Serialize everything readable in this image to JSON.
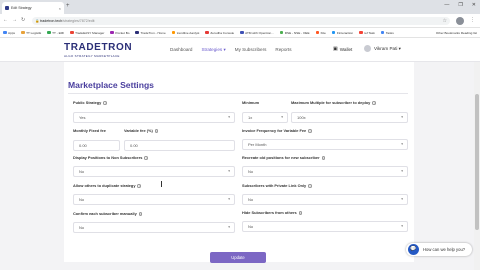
{
  "browser": {
    "tab_title": "Edit Strategy",
    "tab_close": "×",
    "new_tab": "+",
    "window_controls": [
      "—",
      "❐",
      "✕"
    ],
    "url_host": "tradetron.tech",
    "url_path": "/strategies/7872/edit",
    "bookmarks": [
      "Apps",
      "TT Logistik",
      "TT - EMI",
      "TradeEASY Manager",
      "Pocket Bo",
      "TradeTron - Home",
      "trendline Aanlyst",
      "Zerodha Console",
      "ATM with Opention...",
      "RSE - NSE - OEE",
      "Kite",
      "Finteraction",
      "ref Task",
      "Tasks",
      "Other Bookmarks",
      "Reading list"
    ],
    "bookmark_colors": [
      "#4285f4",
      "#e8a23a",
      "#34a853",
      "#ea4335",
      "#9c27b0",
      "#2b2f77",
      "#ff9800",
      "#e53935",
      "#3f51b5",
      "#4caf50",
      "#ff5722",
      "#2196f3",
      "#f44336",
      "#4285f4"
    ]
  },
  "app": {
    "logo_title": "TRADETRON",
    "logo_subtitle": "ALGO STRATEGY MARKETPLACE",
    "nav": [
      {
        "label": "Dashboard",
        "active": false
      },
      {
        "label": "Strategies ▾",
        "active": true
      },
      {
        "label": "My Subscribers",
        "active": false
      },
      {
        "label": "Reports",
        "active": false
      }
    ],
    "wallet_label": "Wallet",
    "user_name": "Vikram Pati ▾",
    "accent": "#6a5acd",
    "brand": "#2b2f77"
  },
  "form": {
    "title": "Marketplace Settings",
    "public_strategy": {
      "label": "Public Strategy",
      "value": "Yes"
    },
    "monthly_fixed_fee": {
      "label": "Monthly Fixed fee",
      "value": "0.00"
    },
    "variable_fee": {
      "label": "Variable fee (%)",
      "value": "0.00"
    },
    "display_positions": {
      "label": "Display Positions to Non Subscribers",
      "value": "No"
    },
    "allow_duplicate": {
      "label": "Allow others to duplicate strategy",
      "value": "No"
    },
    "confirm_manual": {
      "label": "Confirm each subscriber manually",
      "value": "No"
    },
    "minimum": {
      "label": "Minimum",
      "value": "1x"
    },
    "max_multiple": {
      "label": "Maximum Multiple for subscriber to deploy",
      "value": "100x"
    },
    "invoice_frequency": {
      "label": "Invoice Frequency for Variable Fee",
      "value": "Per Month"
    },
    "recreate_positions": {
      "label": "Recreate old positions for new subscriber",
      "value": "No"
    },
    "private_link": {
      "label": "Subscribers with Private Link Only",
      "value": "No"
    },
    "hide_subscribers": {
      "label": "Hide Subscribers from others",
      "value": "No"
    },
    "update_label": "Update"
  },
  "chat": {
    "label": "How can we help you?"
  }
}
